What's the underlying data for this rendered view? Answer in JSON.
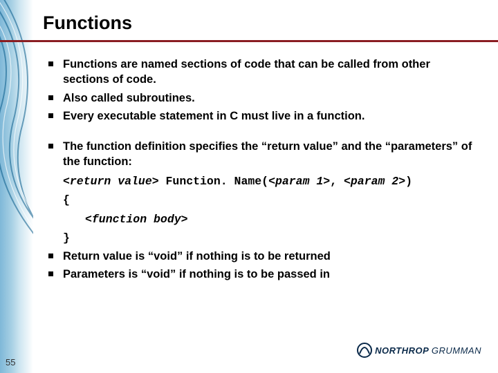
{
  "slide": {
    "title": "Functions",
    "page_number": "55",
    "accent_rule_color": "#8a1d22"
  },
  "group1": [
    "Functions are named sections of code that can be called from other sections of code.",
    "Also called subroutines.",
    "Every executable statement in C must live in a function."
  ],
  "group2_intro": "The function definition specifies the “return value” and the “parameters” of the function:",
  "code": {
    "ret": "<return value>",
    "fn": " Function. Name(",
    "p1": "<param 1>",
    "sep": ", ",
    "p2": "<param 2>",
    "close": ")",
    "obrace": "{",
    "body": "<function body>",
    "cbrace": "}"
  },
  "group2_tail": [
    "Return value is “void” if nothing is to be returned",
    "Parameters is “void” if nothing is to be passed in"
  ],
  "brand": {
    "name1": "NORTHROP",
    "name2": "GRUMMAN"
  }
}
